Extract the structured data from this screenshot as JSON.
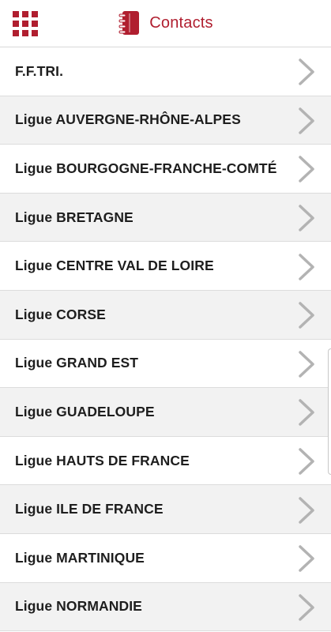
{
  "header": {
    "menu_icon": "grid-menu-icon",
    "title_icon": "contacts-notebook-icon",
    "title": "Contacts",
    "accent_color": "#b01e2f"
  },
  "contacts": {
    "items": [
      {
        "label": "F.F.TRI."
      },
      {
        "label": "Ligue AUVERGNE-RHÔNE-ALPES"
      },
      {
        "label": "Ligue BOURGOGNE-FRANCHE-COMTÉ"
      },
      {
        "label": "Ligue BRETAGNE"
      },
      {
        "label": "Ligue CENTRE VAL DE LOIRE"
      },
      {
        "label": "Ligue CORSE"
      },
      {
        "label": "Ligue GRAND EST"
      },
      {
        "label": "Ligue GUADELOUPE"
      },
      {
        "label": "Ligue HAUTS DE FRANCE"
      },
      {
        "label": "Ligue ILE DE FRANCE"
      },
      {
        "label": "Ligue MARTINIQUE"
      },
      {
        "label": "Ligue NORMANDIE"
      }
    ],
    "row_icon": "chevron-right-icon"
  }
}
